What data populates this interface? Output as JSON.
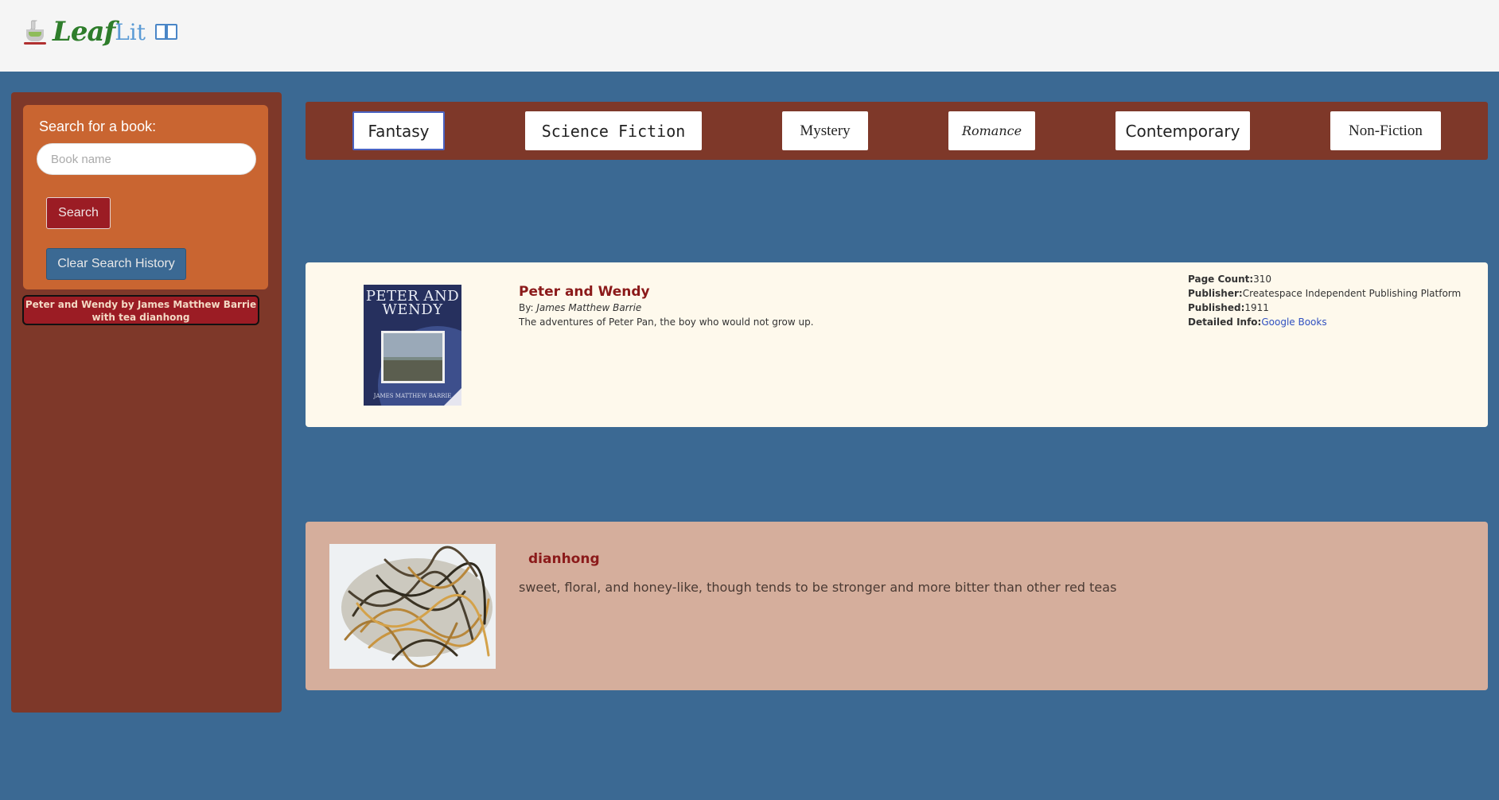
{
  "brand": {
    "name_part1": "Leaf",
    "name_part2": "Lit"
  },
  "search": {
    "label": "Search for a book:",
    "placeholder": "Book name",
    "value": "",
    "search_button": "Search",
    "clear_button": "Clear Search History"
  },
  "history": [
    {
      "line1": "Peter and Wendy by James Matthew Barrie",
      "line2": "with tea dianhong"
    }
  ],
  "genres": [
    "Fantasy",
    "Science Fiction",
    "Mystery",
    "Romance",
    "Contemporary",
    "Non-Fiction"
  ],
  "active_genre": "Fantasy",
  "book": {
    "title": "Peter and Wendy",
    "by_label": "By:",
    "author": "James Matthew Barrie",
    "description": "The adventures of Peter Pan, the boy who would not grow up.",
    "cover": {
      "title": "PETER AND WENDY",
      "author": "JAMES MATTHEW BARRIE"
    },
    "meta": {
      "page_count_label": "Page Count:",
      "page_count": "310",
      "publisher_label": "Publisher:",
      "publisher": "Createspace Independent Publishing Platform",
      "published_label": "Published:",
      "published": "1911",
      "info_label": "Detailed Info:",
      "info_link": "Google Books"
    }
  },
  "tea": {
    "name": "dianhong",
    "description": "sweet, floral, and honey-like, though tends to be stronger and more bitter than other red teas"
  },
  "colors": {
    "page_bg": "#3b6993",
    "sidebar": "#7e3829",
    "search_box": "#c96531",
    "accent_red": "#9b1c24",
    "book_card": "#fef9ec",
    "tea_card": "#d5ae9c"
  }
}
